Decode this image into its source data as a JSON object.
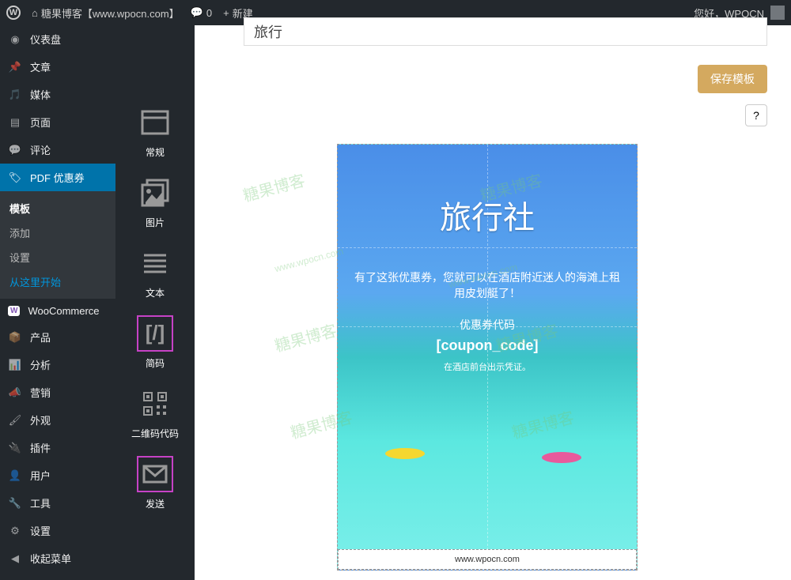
{
  "adminbar": {
    "site_title": "糖果博客【www.wpocn.com】",
    "comments": "0",
    "new_label": "新建",
    "greeting": "您好，WPOCN"
  },
  "sidebar": {
    "items": [
      {
        "icon": "dashboard",
        "label": "仪表盘"
      },
      {
        "icon": "pin",
        "label": "文章"
      },
      {
        "icon": "media",
        "label": "媒体"
      },
      {
        "icon": "page",
        "label": "页面"
      },
      {
        "icon": "comment",
        "label": "评论"
      },
      {
        "icon": "coupon",
        "label": "PDF 优惠券"
      }
    ],
    "submenu": [
      {
        "label": "模板",
        "selected": true
      },
      {
        "label": "添加"
      },
      {
        "label": "设置"
      },
      {
        "label": "从这里开始",
        "blue": true
      }
    ],
    "items2": [
      {
        "icon": "woo",
        "label": "WooCommerce"
      },
      {
        "icon": "product",
        "label": "产品"
      },
      {
        "icon": "analytics",
        "label": "分析"
      },
      {
        "icon": "marketing",
        "label": "营销"
      },
      {
        "icon": "appearance",
        "label": "外观"
      },
      {
        "icon": "plugin",
        "label": "插件"
      },
      {
        "icon": "user",
        "label": "用户"
      },
      {
        "icon": "tool",
        "label": "工具"
      },
      {
        "icon": "settings",
        "label": "设置"
      },
      {
        "icon": "collapse",
        "label": "收起菜单"
      }
    ]
  },
  "editor": {
    "title_value": "旅行",
    "save_button": "保存模板",
    "help": "?"
  },
  "tools": [
    {
      "label": "常规",
      "icon": "layout"
    },
    {
      "label": "图片",
      "icon": "image"
    },
    {
      "label": "文本",
      "icon": "text"
    },
    {
      "label": "简码",
      "icon": "shortcode",
      "active": true
    },
    {
      "label": "二维码代码",
      "icon": "qrcode"
    },
    {
      "label": "发送",
      "icon": "send",
      "active": true
    }
  ],
  "canvas": {
    "title": "旅行社",
    "description": "有了这张优惠券，您就可以在酒店附近迷人的海滩上租用皮划艇了！",
    "code_label": "优惠券代码",
    "code": "[coupon_code]",
    "note": "在酒店前台出示凭证。",
    "footer": "www.wpocn.com"
  },
  "watermark": "糖果博客"
}
